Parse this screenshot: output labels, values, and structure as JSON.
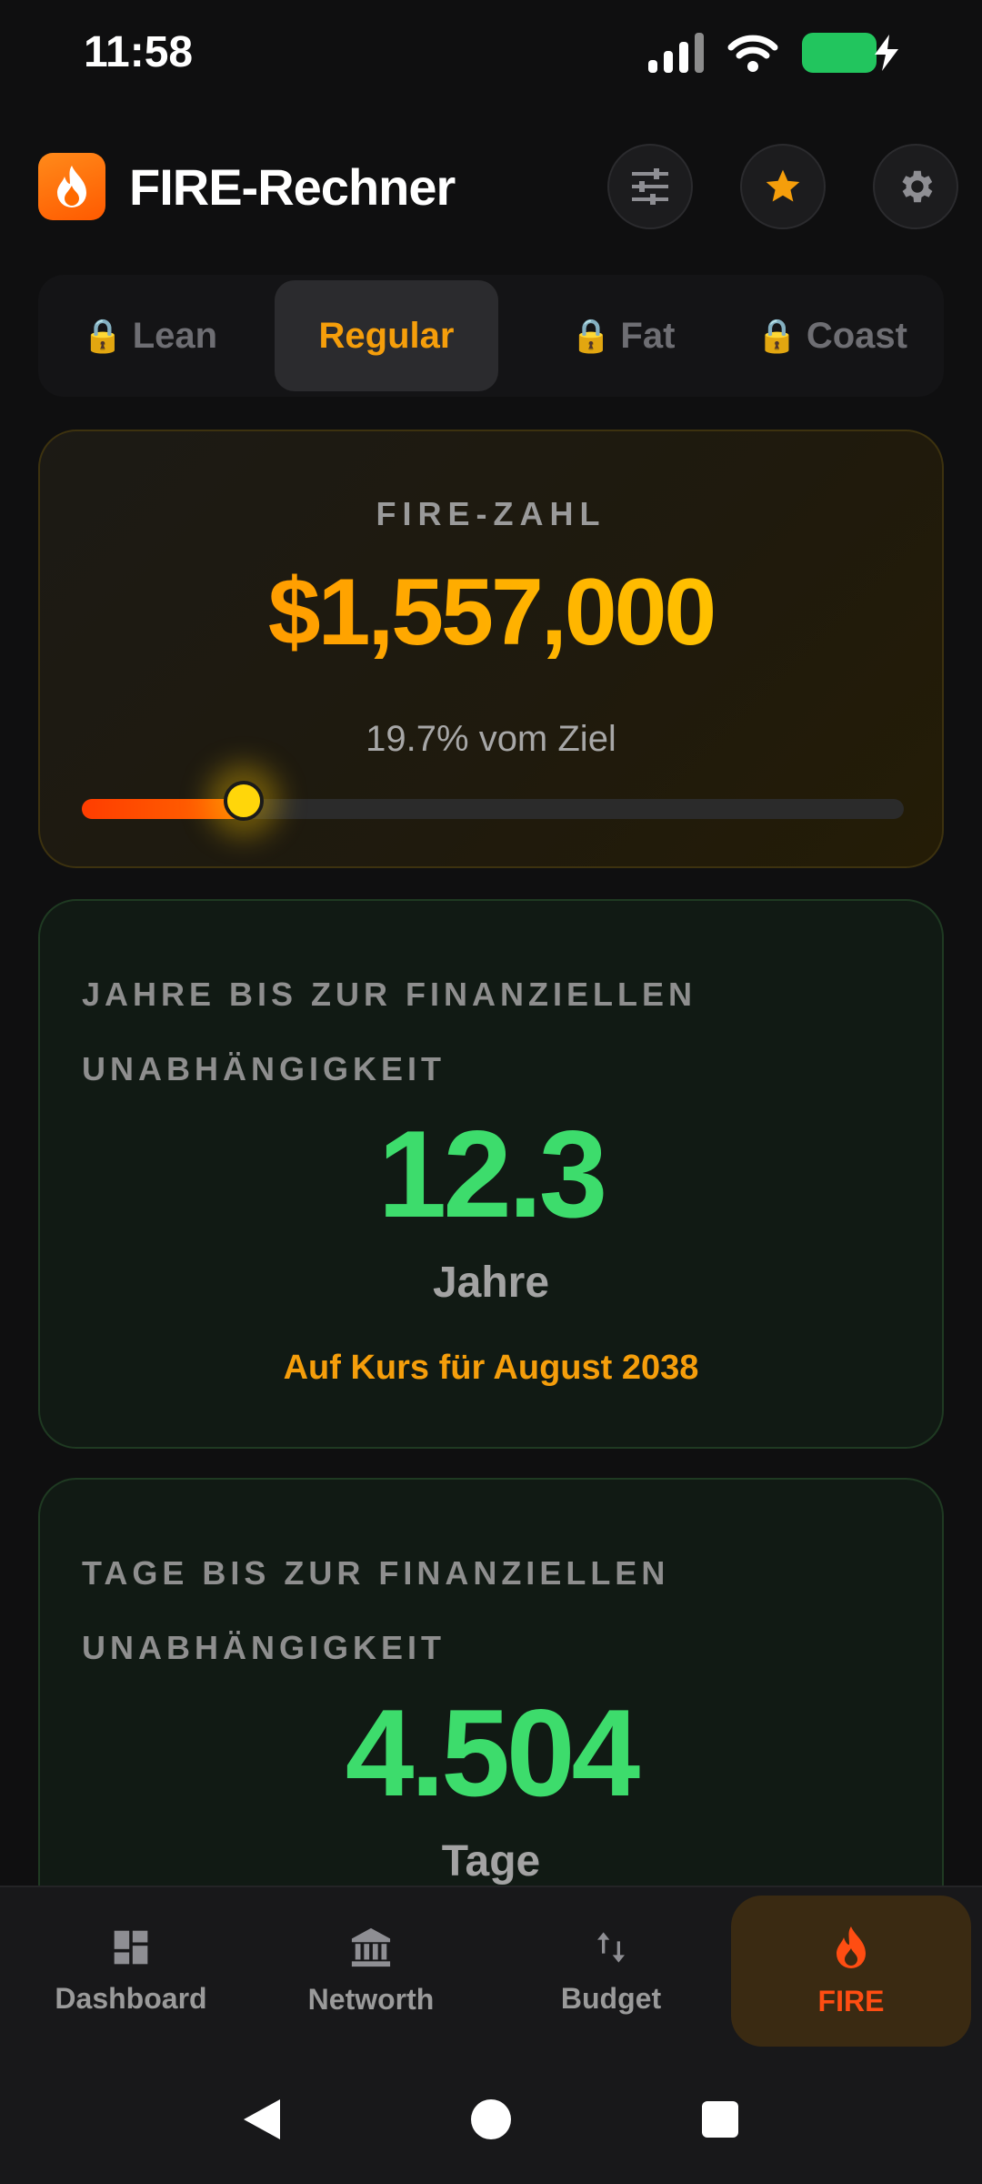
{
  "status_bar": {
    "time": "11:58",
    "icons": [
      "cellular-signal-icon",
      "wifi-icon",
      "battery-charging-icon"
    ]
  },
  "header": {
    "title": "FIRE-Rechner",
    "logo_icon": "flame-icon",
    "actions": [
      "sliders-icon",
      "star-icon",
      "gear-icon"
    ]
  },
  "tabs": [
    {
      "label": "Lean",
      "locked": true
    },
    {
      "label": "Regular",
      "locked": false,
      "active": true
    },
    {
      "label": "Fat",
      "locked": true
    },
    {
      "label": "Coast",
      "locked": true
    }
  ],
  "fire_card": {
    "label": "FIRE-ZAHL",
    "amount": "$1,557,000",
    "progress_text": "19.7% vom Ziel",
    "progress_fraction": 0.197
  },
  "years_card": {
    "label": "JAHRE BIS ZUR FINANZIELLEN UNABHÄNGIGKEIT",
    "value": "12.3",
    "unit": "Jahre",
    "note": "Auf Kurs für August 2038"
  },
  "days_card": {
    "label": "TAGE BIS ZUR FINANZIELLEN UNABHÄNGIGKEIT",
    "value": "4.504",
    "unit": "Tage"
  },
  "bottom_nav": [
    {
      "label": "Dashboard",
      "icon": "dashboard-icon"
    },
    {
      "label": "Networth",
      "icon": "bank-icon"
    },
    {
      "label": "Budget",
      "icon": "transfer-arrows-icon"
    },
    {
      "label": "FIRE",
      "icon": "flame-icon",
      "active": true
    }
  ],
  "colors": {
    "accent": "#f59e0b",
    "fire_active": "#ff4d12",
    "positive_green": "#3ddc6c",
    "background": "#0f0f10"
  }
}
